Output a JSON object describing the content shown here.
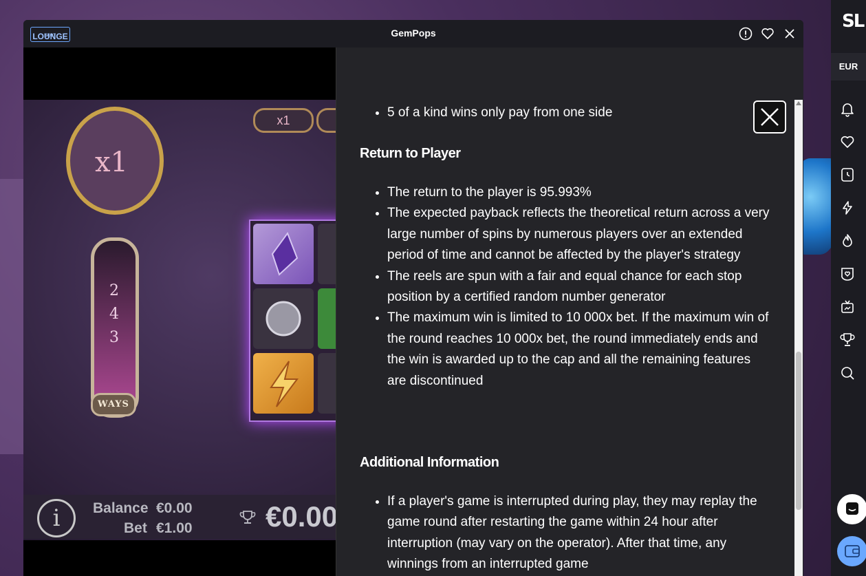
{
  "window": {
    "title": "GemPops",
    "logo_small": "SLOT",
    "logo_text": "LOUNGE"
  },
  "game": {
    "multiplier_badge": "x1",
    "top_multiplier": "x1",
    "ways_digits": [
      "2",
      "4",
      "3"
    ],
    "ways_label": "WAYS",
    "info_icon": "i",
    "balance_label": "Balance",
    "balance_value": "€0.00",
    "bet_label": "Bet",
    "bet_value": "€1.00",
    "win_value": "€0.00"
  },
  "paytable": {
    "top_item": "5 of a kind wins only pay from one side",
    "rtp_heading": "Return to Player",
    "rtp_items": [
      "The return to the player is 95.993%",
      "The expected payback reflects the theoretical return across a very large number of spins by numerous players over an extended period of time and cannot be affected by the player's strategy",
      "The reels are spun with a fair and equal chance for each stop position by a certified random number generator",
      "The maximum win is limited to 10 000x bet. If the maximum win of the round reaches 10 000x bet, the round immediately ends and the win is awarded up to the cap and all the remaining features are discontinued"
    ],
    "additional_heading": "Additional Information",
    "additional_items": [
      "If a player's game is interrupted during play, they may replay the game round after restarting the game within 24 hour after interruption (may vary on the operator). After that time, any winnings from an interrupted game"
    ]
  },
  "sidebar": {
    "logo": "SL",
    "currency": "EUR",
    "icons": [
      "bell-icon",
      "heart-icon",
      "clock-icon",
      "lightning-icon",
      "flame-icon",
      "shield-heart-icon",
      "tv-icon",
      "trophy-icon",
      "search-icon"
    ]
  },
  "colors": {
    "window_bg": "#1a1a1f",
    "panel_bg": "#242428",
    "sidebar_bg": "#1c1c22",
    "accent_blue": "#6aa8ff"
  }
}
